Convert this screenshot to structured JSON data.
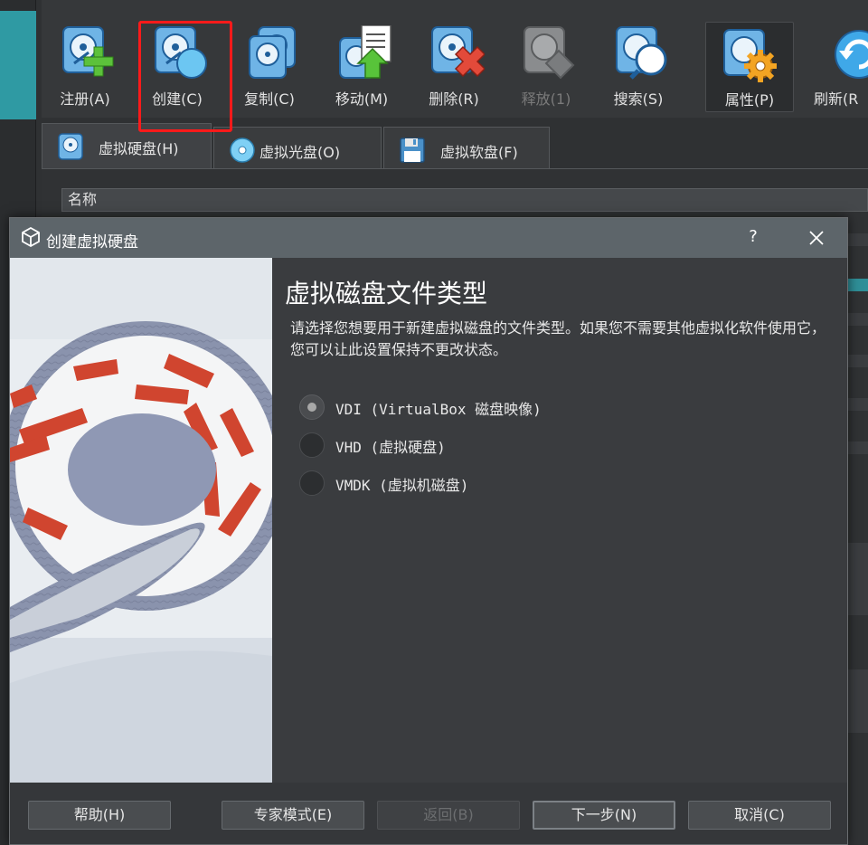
{
  "toolbar": {
    "buttons": [
      {
        "label": "注册(A)"
      },
      {
        "label": "创建(C)"
      },
      {
        "label": "复制(C)"
      },
      {
        "label": "移动(M)"
      },
      {
        "label": "删除(R)"
      },
      {
        "label": "释放(1)"
      },
      {
        "label": "搜索(S)"
      },
      {
        "label": "属性(P)"
      },
      {
        "label": "刷新(R"
      }
    ]
  },
  "tabs": [
    {
      "label": "虚拟硬盘(H)"
    },
    {
      "label": "虚拟光盘(O)"
    },
    {
      "label": "虚拟软盘(F)"
    }
  ],
  "table": {
    "name_header": "名称"
  },
  "dialog": {
    "title": "创建虚拟硬盘",
    "help_glyph": "?",
    "page_title": "虚拟磁盘文件类型",
    "description": "请选择您想要用于新建虚拟磁盘的文件类型。如果您不需要其他虚拟化软件使用它，您可以让此设置保持不更改状态。",
    "options": [
      {
        "label": "VDI (VirtualBox 磁盘映像)",
        "checked": true
      },
      {
        "label": "VHD (虚拟硬盘)",
        "checked": false
      },
      {
        "label": "VMDK (虚拟机磁盘)",
        "checked": false
      }
    ],
    "buttons": {
      "help": "帮助(H)",
      "expert": "专家模式(E)",
      "back": "返回(B)",
      "next": "下一步(N)",
      "cancel": "取消(C)"
    }
  },
  "colors": {
    "accent_teal": "#2f9aa3",
    "highlight_red": "#ff1a1a",
    "titlebar": "#5d656a"
  }
}
